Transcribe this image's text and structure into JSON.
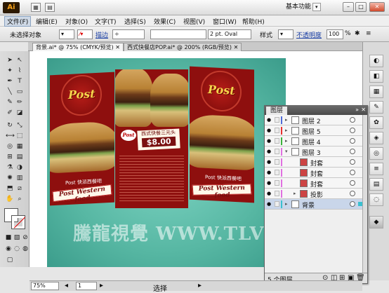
{
  "app": {
    "logo": "Ai",
    "workspace_label": "基本功能"
  },
  "menu": [
    "文件(F)",
    "编辑(E)",
    "对象(O)",
    "文字(T)",
    "选择(S)",
    "效果(C)",
    "视图(V)",
    "窗口(W)",
    "帮助(H)"
  ],
  "control_bar": {
    "selection_status": "未选择对象",
    "stroke_label": "描边",
    "brush_value": "2 pt. Oval",
    "style_label": "样式",
    "opacity_label": "不透明度",
    "opacity_value": "100",
    "percent": "%"
  },
  "tabs": [
    {
      "label": "背景.ai* @ 75% (CMYK/预览)",
      "active": true
    },
    {
      "label": "西式快餐店POP.ai* @ 200% (RGB/预览)",
      "active": false
    }
  ],
  "artwork": {
    "post_text": "Post",
    "cn_brand": "Post 快派西餐吧",
    "en_brand": "Post Western food",
    "price_title": "西式快餐三元头",
    "price": "$8.00",
    "watermark": "騰龍視覺 WWW.TLVI.NET"
  },
  "layers_panel": {
    "tab_label": "图层",
    "rows": [
      {
        "name": "图层 2",
        "color": "#4f6bd8",
        "expandable": true,
        "indent": 0,
        "selected": false
      },
      {
        "name": "图层 5",
        "color": "#e83030",
        "expandable": true,
        "indent": 0,
        "selected": false
      },
      {
        "name": "图层 4",
        "color": "#3bb23b",
        "expandable": true,
        "indent": 0,
        "selected": false
      },
      {
        "name": "图层 3",
        "color": "#e070e0",
        "expandable": true,
        "indent": 0,
        "selected": false,
        "expanded": true
      },
      {
        "name": "封套",
        "color": "#e070e0",
        "expandable": false,
        "indent": 1,
        "selected": false
      },
      {
        "name": "封套",
        "color": "#e070e0",
        "expandable": false,
        "indent": 1,
        "selected": false
      },
      {
        "name": "封套",
        "color": "#e070e0",
        "expandable": false,
        "indent": 1,
        "selected": false
      },
      {
        "name": "投影",
        "color": "#e070e0",
        "expandable": true,
        "indent": 1,
        "selected": false
      },
      {
        "name": "背景",
        "color": "#3ac0d0",
        "expandable": true,
        "indent": 0,
        "selected": true
      }
    ],
    "footer_label": "5 个图层"
  },
  "status": {
    "zoom": "75%",
    "page": "1",
    "tool": "选择"
  }
}
